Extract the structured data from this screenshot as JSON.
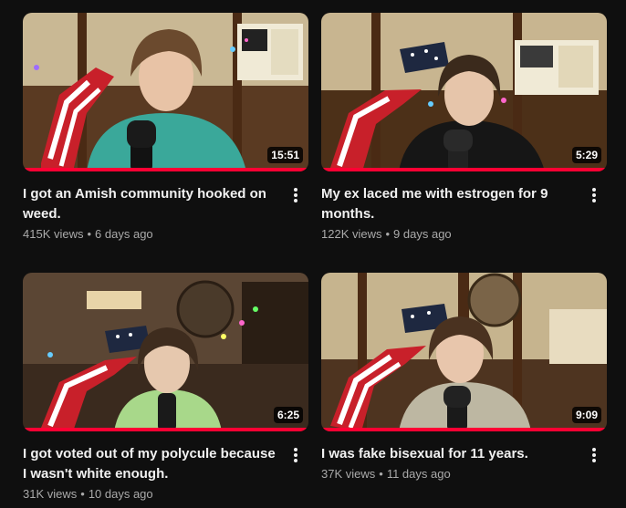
{
  "videos": [
    {
      "title": "I got an Amish community hooked on weed.",
      "views": "415K views",
      "age": "6 days ago",
      "duration": "15:51",
      "watch_progress": 1.0,
      "shirt_color": "#3aa89a"
    },
    {
      "title": "My ex laced me with estrogen for 9 months.",
      "views": "122K views",
      "age": "9 days ago",
      "duration": "5:29",
      "watch_progress": 1.0,
      "shirt_color": "#161616"
    },
    {
      "title": "I got voted out of my polycule because I wasn't white enough.",
      "views": "31K views",
      "age": "10 days ago",
      "duration": "6:25",
      "watch_progress": 1.0,
      "shirt_color": "#a8d88a"
    },
    {
      "title": "I was fake bisexual for 11 years.",
      "views": "37K views",
      "age": "11 days ago",
      "duration": "9:09",
      "watch_progress": 1.0,
      "shirt_color": "#bdb7a2"
    }
  ],
  "separator": "•",
  "colors": {
    "background": "#0f0f0f",
    "progress": "#ff0033",
    "title": "#f1f1f1",
    "meta": "#aaaaaa"
  }
}
